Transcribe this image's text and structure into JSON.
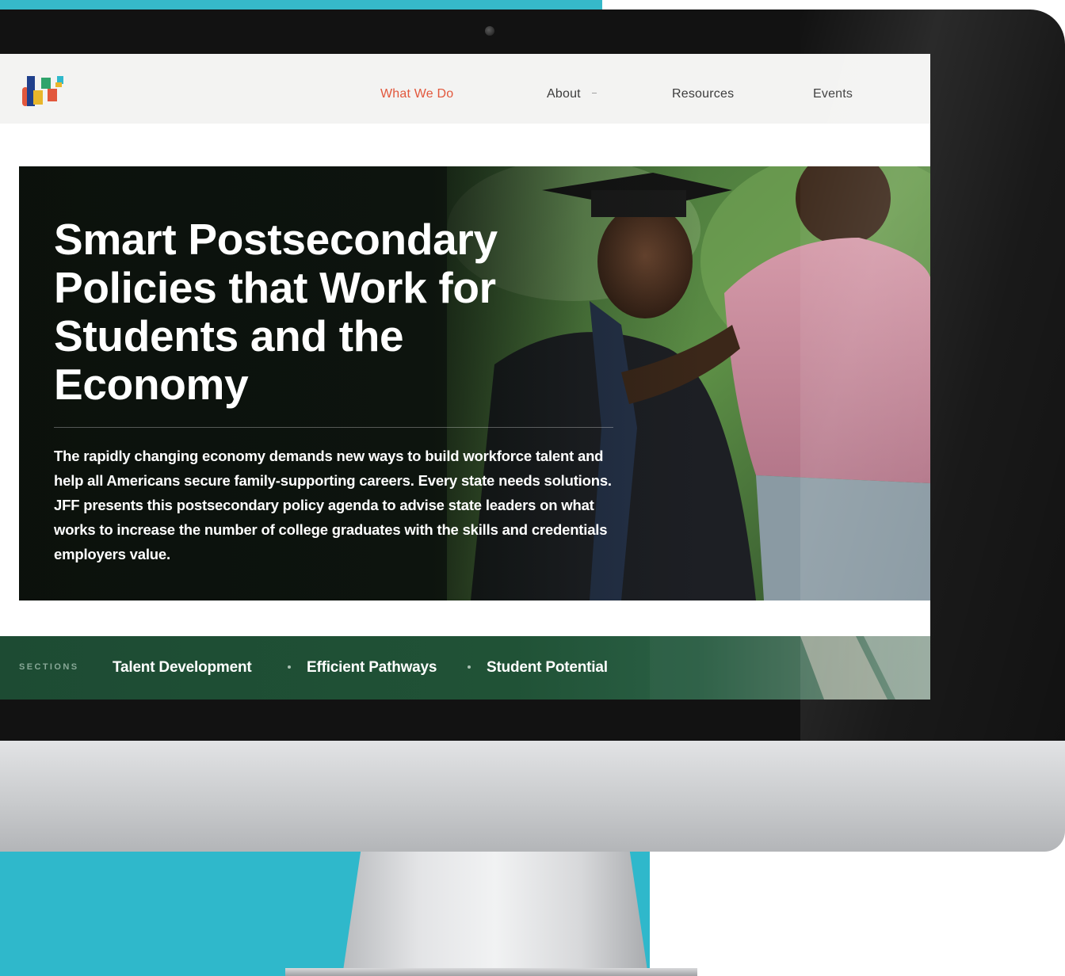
{
  "brand": {
    "logo_name": "JFF",
    "colors": {
      "active_nav": "#e2573c",
      "hero_dark": "#151d16",
      "sections_green": "#1d4b33",
      "backdrop_teal": "#2fb8cb"
    }
  },
  "nav": {
    "items": [
      {
        "label": "What We Do",
        "active": true
      },
      {
        "label": "About",
        "active": false
      },
      {
        "label": "Resources",
        "active": false
      },
      {
        "label": "Events",
        "active": false
      }
    ]
  },
  "hero": {
    "title": "Smart Postsecondary Policies that Work for Students and the Economy",
    "body": "The rapidly changing economy demands new ways to build workforce talent and help all Americans secure family-supporting careers. Every state needs solutions. JFF presents this postsecondary policy agenda to advise state leaders on what works to increase the number of college graduates with the skills and credentials employers value."
  },
  "sections": {
    "label": "SECTIONS",
    "links": [
      "Talent Development",
      "Efficient Pathways",
      "Student Potential"
    ]
  }
}
